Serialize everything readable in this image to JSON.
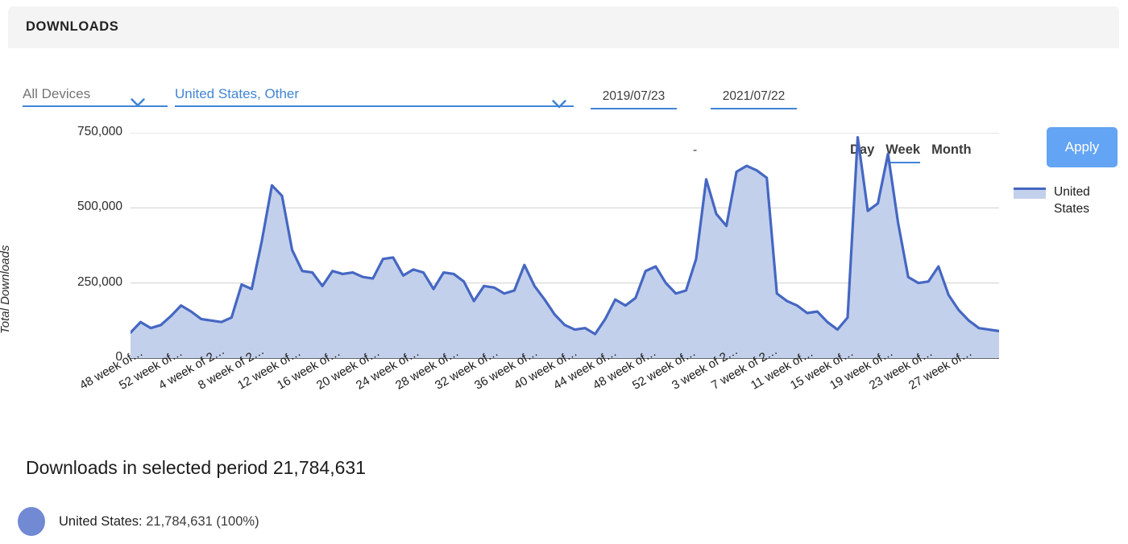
{
  "panel": {
    "title": "DOWNLOADS"
  },
  "toolbar": {
    "devices_value": "All Devices",
    "country_value": "United States,  Other",
    "date_from": "2019/07/23",
    "date_separator": "-",
    "date_to": "2021/07/22",
    "granularity": [
      {
        "label": "Day",
        "active": false
      },
      {
        "label": "Week",
        "active": true
      },
      {
        "label": "Month",
        "active": false
      }
    ],
    "apply_label": "Apply",
    "accent_color": "#4285d6",
    "apply_color": "#63a4f4"
  },
  "summary": {
    "title": "Downloads in selected period 21,784,631",
    "legend_name": "United States:",
    "legend_value": " 21,784,631 (100%)",
    "dot_color": "#7289d4"
  },
  "chart_data": {
    "type": "area",
    "title": "",
    "xlabel": "",
    "ylabel": "Total Downloads",
    "ylim": [
      0,
      750000
    ],
    "yticks": [
      0,
      250000,
      500000,
      750000
    ],
    "ytick_labels": [
      "0",
      "250,000",
      "500,000",
      "750,000"
    ],
    "grid": true,
    "legend_position": "right",
    "line_color": "#4567c2",
    "fill_color": "#c3d0ec",
    "series": [
      {
        "name": "United States",
        "values": [
          85000,
          120000,
          100000,
          110000,
          140000,
          175000,
          155000,
          130000,
          125000,
          120000,
          135000,
          245000,
          230000,
          390000,
          575000,
          540000,
          360000,
          290000,
          285000,
          240000,
          290000,
          280000,
          285000,
          270000,
          265000,
          330000,
          335000,
          275000,
          295000,
          285000,
          230000,
          285000,
          280000,
          255000,
          190000,
          240000,
          235000,
          215000,
          225000,
          310000,
          240000,
          195000,
          145000,
          110000,
          95000,
          100000,
          80000,
          130000,
          195000,
          175000,
          200000,
          290000,
          305000,
          250000,
          215000,
          225000,
          330000,
          595000,
          480000,
          440000,
          620000,
          640000,
          625000,
          600000,
          215000,
          190000,
          175000,
          150000,
          155000,
          120000,
          95000,
          135000,
          735000,
          490000,
          515000,
          680000,
          450000,
          270000,
          250000,
          255000,
          305000,
          210000,
          160000,
          125000,
          100000,
          95000,
          90000
        ]
      }
    ],
    "x_tick_labels": [
      "48 week of…",
      "52 week of…",
      "4 week of 2…",
      "8 week of 2…",
      "12 week of…",
      "16 week of…",
      "20 week of…",
      "24 week of…",
      "28 week of…",
      "32 week of…",
      "36 week of…",
      "40 week of…",
      "44 week of…",
      "48 week of…",
      "52 week of…",
      "3 week of 2…",
      "7 week of 2…",
      "11 week of…",
      "15 week of…",
      "19 week of…",
      "23 week of…",
      "27 week of…"
    ],
    "legend_entries": [
      "United States"
    ]
  }
}
